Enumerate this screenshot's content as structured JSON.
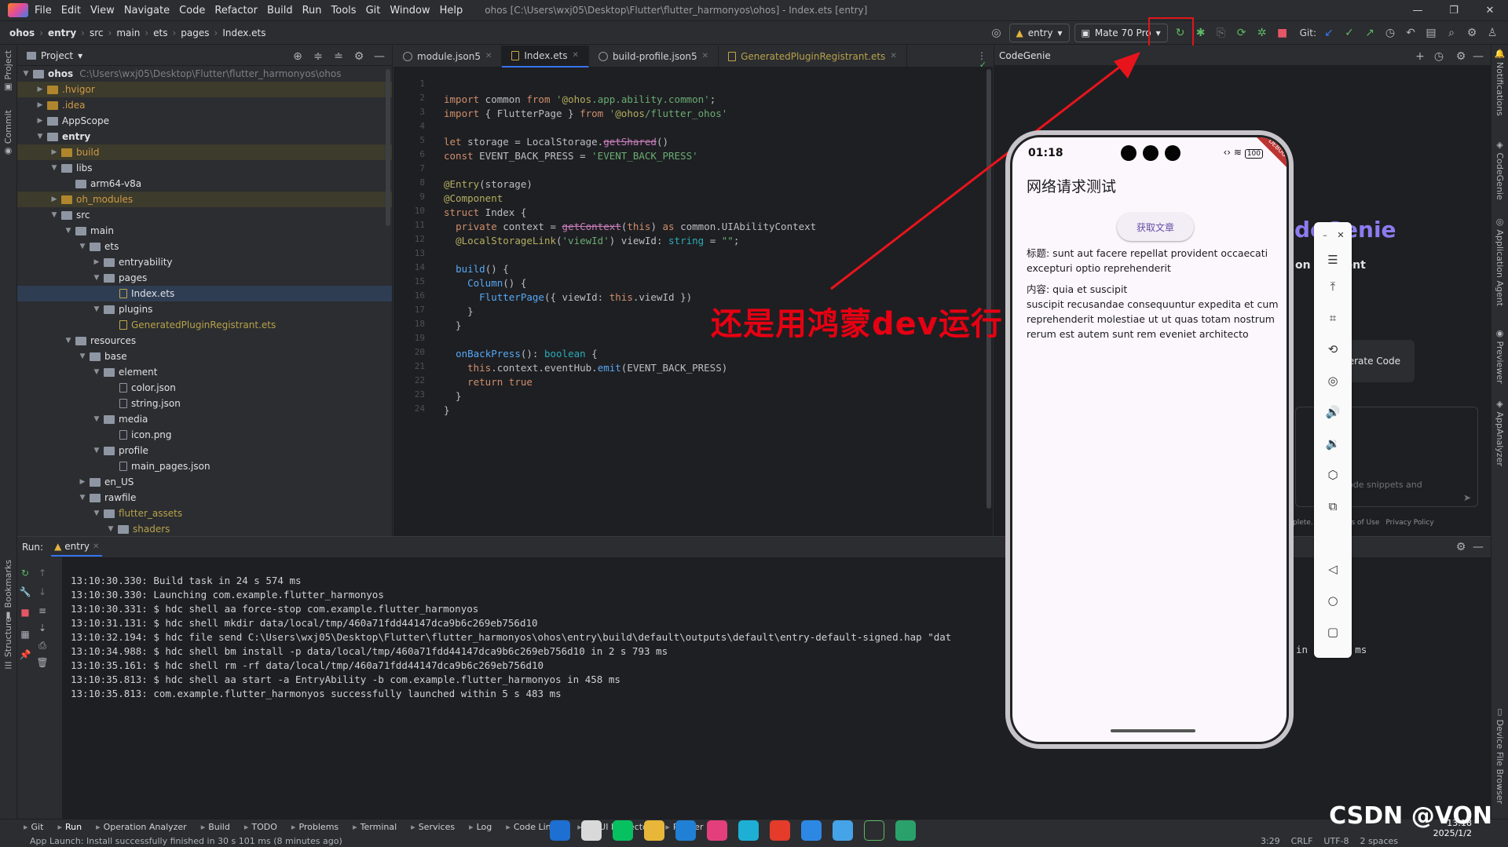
{
  "menubar": {
    "items": [
      "File",
      "Edit",
      "View",
      "Navigate",
      "Code",
      "Refactor",
      "Build",
      "Run",
      "Tools",
      "Git",
      "Window",
      "Help"
    ],
    "window_title": "ohos [C:\\Users\\wxj05\\Desktop\\Flutter\\flutter_harmonyos\\ohos] - Index.ets [entry]"
  },
  "breadcrumb": [
    "ohos",
    "entry",
    "src",
    "main",
    "ets",
    "pages",
    "Index.ets"
  ],
  "toolbar": {
    "module_combo": "entry",
    "device_combo": "Mate 70 Pro",
    "git_label": "Git:"
  },
  "project": {
    "header": "Project",
    "root_label": "ohos",
    "root_path": "C:\\Users\\wxj05\\Desktop\\Flutter\\flutter_harmonyos\\ohos",
    "rows": [
      {
        "label": ".hvigor",
        "depth": 1,
        "kind": "folder",
        "open": false,
        "style": "excl",
        "hl": true
      },
      {
        "label": ".idea",
        "depth": 1,
        "kind": "folder",
        "open": false,
        "style": "excl",
        "hl": false
      },
      {
        "label": "AppScope",
        "depth": 1,
        "kind": "folder",
        "open": false,
        "style": "",
        "hl": false
      },
      {
        "label": "entry",
        "depth": 1,
        "kind": "folder",
        "open": true,
        "style": "bold",
        "hl": false
      },
      {
        "label": "build",
        "depth": 2,
        "kind": "folder",
        "open": false,
        "style": "excl",
        "hl": true
      },
      {
        "label": "libs",
        "depth": 2,
        "kind": "folder",
        "open": true,
        "style": "",
        "hl": false
      },
      {
        "label": "arm64-v8a",
        "depth": 3,
        "kind": "folder",
        "open": null,
        "style": "",
        "hl": false
      },
      {
        "label": "oh_modules",
        "depth": 2,
        "kind": "folder",
        "open": false,
        "style": "excl",
        "hl": true
      },
      {
        "label": "src",
        "depth": 2,
        "kind": "folder",
        "open": true,
        "style": "",
        "hl": false
      },
      {
        "label": "main",
        "depth": 3,
        "kind": "folder",
        "open": true,
        "style": "",
        "hl": false
      },
      {
        "label": "ets",
        "depth": 4,
        "kind": "folder",
        "open": true,
        "style": "",
        "hl": false
      },
      {
        "label": "entryability",
        "depth": 5,
        "kind": "folder",
        "open": false,
        "style": "",
        "hl": false
      },
      {
        "label": "pages",
        "depth": 5,
        "kind": "folder",
        "open": true,
        "style": "",
        "hl": false
      },
      {
        "label": "Index.ets",
        "depth": 6,
        "kind": "ets",
        "open": null,
        "style": "",
        "hl": false
      },
      {
        "label": "plugins",
        "depth": 5,
        "kind": "folder",
        "open": true,
        "style": "",
        "hl": false
      },
      {
        "label": "GeneratedPluginRegistrant.ets",
        "depth": 6,
        "kind": "ets",
        "open": null,
        "style": "gen",
        "hl": false
      },
      {
        "label": "resources",
        "depth": 3,
        "kind": "folder",
        "open": true,
        "style": "",
        "hl": false
      },
      {
        "label": "base",
        "depth": 4,
        "kind": "folder",
        "open": true,
        "style": "",
        "hl": false
      },
      {
        "label": "element",
        "depth": 5,
        "kind": "folder",
        "open": true,
        "style": "",
        "hl": false
      },
      {
        "label": "color.json",
        "depth": 6,
        "kind": "file",
        "open": null,
        "style": "",
        "hl": false
      },
      {
        "label": "string.json",
        "depth": 6,
        "kind": "file",
        "open": null,
        "style": "",
        "hl": false
      },
      {
        "label": "media",
        "depth": 5,
        "kind": "folder",
        "open": true,
        "style": "",
        "hl": false
      },
      {
        "label": "icon.png",
        "depth": 6,
        "kind": "file",
        "open": null,
        "style": "",
        "hl": false
      },
      {
        "label": "profile",
        "depth": 5,
        "kind": "folder",
        "open": true,
        "style": "",
        "hl": false
      },
      {
        "label": "main_pages.json",
        "depth": 6,
        "kind": "file",
        "open": null,
        "style": "",
        "hl": false
      },
      {
        "label": "en_US",
        "depth": 4,
        "kind": "folder",
        "open": false,
        "style": "",
        "hl": false
      },
      {
        "label": "rawfile",
        "depth": 4,
        "kind": "folder",
        "open": true,
        "style": "",
        "hl": false
      },
      {
        "label": "flutter_assets",
        "depth": 5,
        "kind": "folder",
        "open": true,
        "style": "gen",
        "hl": false
      },
      {
        "label": "shaders",
        "depth": 6,
        "kind": "folder",
        "open": true,
        "style": "gen",
        "hl": false
      }
    ]
  },
  "tabs": [
    {
      "label": "module.json5",
      "active": false,
      "kind": "json",
      "gen": false
    },
    {
      "label": "Index.ets",
      "active": true,
      "kind": "ets",
      "gen": false
    },
    {
      "label": "build-profile.json5",
      "active": false,
      "kind": "json",
      "gen": false
    },
    {
      "label": "GeneratedPluginRegistrant.ets",
      "active": false,
      "kind": "ets",
      "gen": true
    }
  ],
  "code_lines": [
    "",
    "import common from '@ohos.app.ability.common';",
    "import { FlutterPage } from '@ohos/flutter_ohos'",
    "",
    "let storage = LocalStorage.getShared()",
    "const EVENT_BACK_PRESS = 'EVENT_BACK_PRESS'",
    "",
    "@Entry(storage)",
    "@Component",
    "struct Index {",
    "  private context = getContext(this) as common.UIAbilityContext",
    "  @LocalStorageLink('viewId') viewId: string = \"\";",
    "",
    "  build() {",
    "    Column() {",
    "      FlutterPage({ viewId: this.viewId })",
    "    }",
    "  }",
    "",
    "  onBackPress(): boolean {",
    "    this.context.eventHub.emit(EVENT_BACK_PRESS)",
    "    return true",
    "  }",
    "}"
  ],
  "codegenie": {
    "header": "CodeGenie",
    "bg_title": "deGenie",
    "bg_sub": "on    pment",
    "gen_btn": "erate Code",
    "hint": "code snippets and",
    "links": [
      "plete.",
      "ms of Use",
      "Privacy Policy"
    ]
  },
  "run": {
    "label": "Run:",
    "tab": "entry",
    "log": [
      "13:10:30.330: Build task in 24 s 574 ms",
      "13:10:30.330: Launching com.example.flutter_harmonyos",
      "13:10:30.331: $ hdc shell aa force-stop com.example.flutter_harmonyos",
      "13:10:31.131: $ hdc shell mkdir data/local/tmp/460a71fdd44147dca9b6c269eb756d10",
      "13:10:32.194: $ hdc file send C:\\Users\\wxj05\\Desktop\\Flutter\\flutter_harmonyos\\ohos\\entry\\build\\default\\outputs\\default\\entry-default-signed.hap \"dat",
      "13:10:34.988: $ hdc shell bm install -p data/local/tmp/460a71fdd44147dca9b6c269eb756d10 in 2 s 793 ms",
      "13:10:35.161: $ hdc shell rm -rf data/local/tmp/460a71fdd44147dca9b6c269eb756d10",
      "13:10:35.813: $ hdc shell aa start -a EntryAbility -b com.example.flutter_harmonyos in 458 ms",
      "13:10:35.813: com.example.flutter_harmonyos successfully launched within 5 s 483 ms"
    ],
    "overflow_tail": "in        ms"
  },
  "toolwindows": [
    "Git",
    "Run",
    "Operation Analyzer",
    "Build",
    "TODO",
    "Problems",
    "Terminal",
    "Services",
    "Log",
    "Code Linter",
    "ArkUI Inspector",
    "Profiler"
  ],
  "statusbar": {
    "message": "App Launch: Install successfully finished in 30 s 101 ms (8 minutes ago)",
    "pos": "3:29",
    "eol": "CRLF",
    "enc": "UTF-8",
    "indent": "2 spaces"
  },
  "phone": {
    "time": "01:18",
    "battery": "100",
    "debug": "DEBUG",
    "title": "网络请求测试",
    "button": "获取文章",
    "title_label": "标题: sunt aut facere repellat provident occaecati excepturi optio reprehenderit",
    "body_label": "内容: quia et suscipit",
    "body_text": "suscipit recusandae consequuntur expedita et cum reprehenderit molestiae ut ut quas totam nostrum rerum est autem sunt rem eveniet architecto"
  },
  "annotation": "还是用鸿蒙dev运行",
  "watermark": "CSDN @VON",
  "clock": {
    "time": "13:18",
    "date": "2025/1/2"
  },
  "colors": {
    "accent": "#3574f0",
    "annotation_red": "#e60012",
    "ide_bg": "#1e1f22"
  }
}
